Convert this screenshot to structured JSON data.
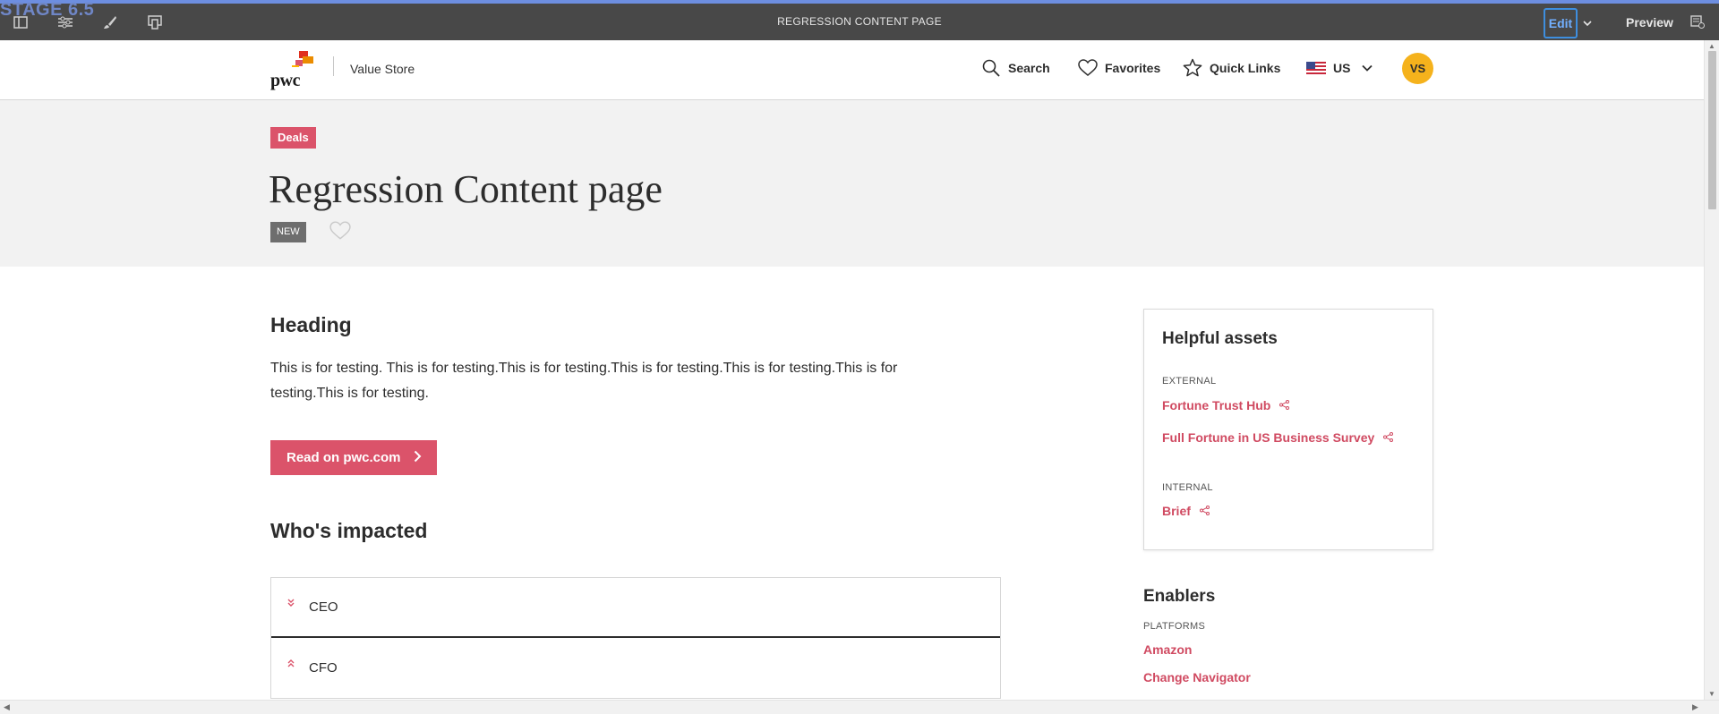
{
  "aem": {
    "stage_label": "STAGE 6.5",
    "page_title": "REGRESSION CONTENT PAGE",
    "edit_label": "Edit",
    "preview_label": "Preview",
    "icons": [
      "side-panel-icon",
      "page-properties-icon",
      "brush-icon",
      "emulator-icon"
    ]
  },
  "header": {
    "logo_text": "pwc",
    "site_name": "Value Store",
    "nav": {
      "search": "Search",
      "favorites": "Favorites",
      "quick_links": "Quick Links",
      "region": "US"
    },
    "avatar_initials": "VS"
  },
  "hero": {
    "tag": "Deals",
    "title": "Regression Content page",
    "new_badge": "NEW"
  },
  "main": {
    "heading": "Heading",
    "paragraph": "This is for testing. This is for testing.This is for testing.This is for testing.This is for testing.This is for testing.This is for testing.",
    "cta_label": "Read on pwc.com",
    "impacted_heading": "Who's impacted",
    "accordion": [
      {
        "label": "CEO",
        "state": "collapsed"
      },
      {
        "label": "CFO",
        "state": "expanded"
      }
    ]
  },
  "sidebar": {
    "assets_title": "Helpful assets",
    "external_label": "EXTERNAL",
    "external_links": [
      "Fortune Trust Hub",
      "Full Fortune in US Business Survey"
    ],
    "internal_label": "INTERNAL",
    "internal_links": [
      "Brief"
    ],
    "enablers_title": "Enablers",
    "platforms_label": "PLATFORMS",
    "platforms": [
      "Amazon",
      "Change Navigator"
    ]
  },
  "colors": {
    "accent": "#db536a",
    "link": "#d04a61",
    "toolbar": "#484848",
    "avatar": "#f5b21c",
    "hero_bg": "#f2f2f2"
  }
}
